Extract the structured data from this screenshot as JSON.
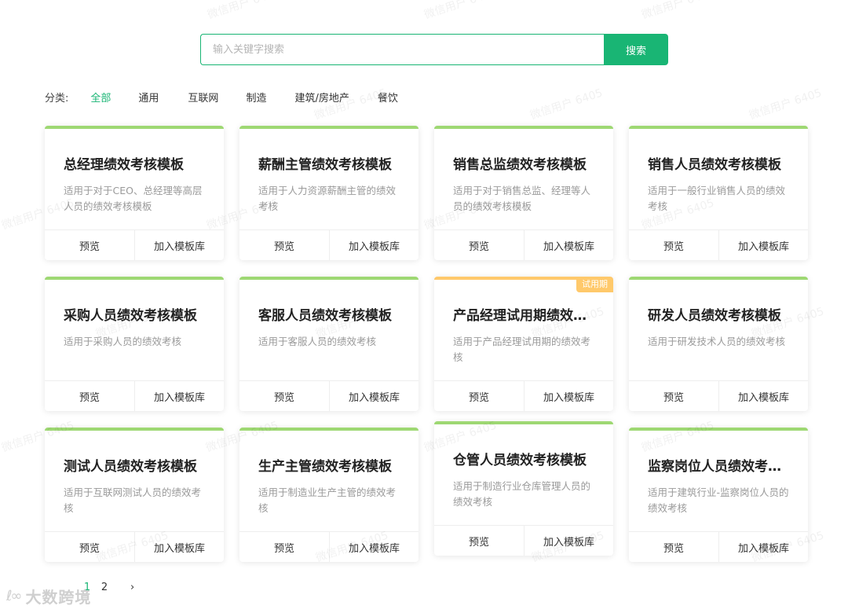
{
  "search": {
    "placeholder": "输入关键字搜索",
    "button_label": "搜索"
  },
  "categories": {
    "label": "分类:",
    "items": [
      "全部",
      "通用",
      "互联网",
      "制造",
      "建筑/房地产",
      "餐饮"
    ],
    "active": "全部"
  },
  "cards": [
    {
      "title": "总经理绩效考核模板",
      "desc": "适用于对于CEO、总经理等高层人员的绩效考核模板"
    },
    {
      "title": "薪酬主管绩效考核模板",
      "desc": "适用于人力资源薪酬主管的绩效考核"
    },
    {
      "title": "销售总监绩效考核模板",
      "desc": "适用于对于销售总监、经理等人员的绩效考核模板"
    },
    {
      "title": "销售人员绩效考核模板",
      "desc": "适用于一般行业销售人员的绩效考核"
    },
    {
      "title": "采购人员绩效考核模板",
      "desc": "适用于采购人员的绩效考核"
    },
    {
      "title": "客服人员绩效考核模板",
      "desc": "适用于客服人员的绩效考核"
    },
    {
      "title": "产品经理试用期绩效考核模板",
      "desc": "适用于产品经理试用期的绩效考核",
      "badge": "试用期"
    },
    {
      "title": "研发人员绩效考核模板",
      "desc": "适用于研发技术人员的绩效考核"
    },
    {
      "title": "测试人员绩效考核模板",
      "desc": "适用于互联网测试人员的绩效考核"
    },
    {
      "title": "生产主管绩效考核模板",
      "desc": "适用于制造业生产主管的绩效考核"
    },
    {
      "title": "仓管人员绩效考核模板",
      "desc": "适用于制造行业仓库管理人员的绩效考核"
    },
    {
      "title": "监察岗位人员绩效考核模板",
      "desc": "适用于建筑行业-监察岗位人员的绩效考核"
    }
  ],
  "card_actions": {
    "preview": "预览",
    "add": "加入模板库"
  },
  "pagination": {
    "pages": [
      "1",
      "2"
    ],
    "current": "1",
    "next_icon": "chevron-right-icon",
    "next_glyph": "›"
  },
  "watermark": {
    "text": "微信用户 6405"
  },
  "brand": {
    "logo_text": "大数跨境"
  },
  "colors": {
    "accent": "#19b574",
    "card_top_border": "#9ed873",
    "trial_badge": "#ffc96b"
  }
}
